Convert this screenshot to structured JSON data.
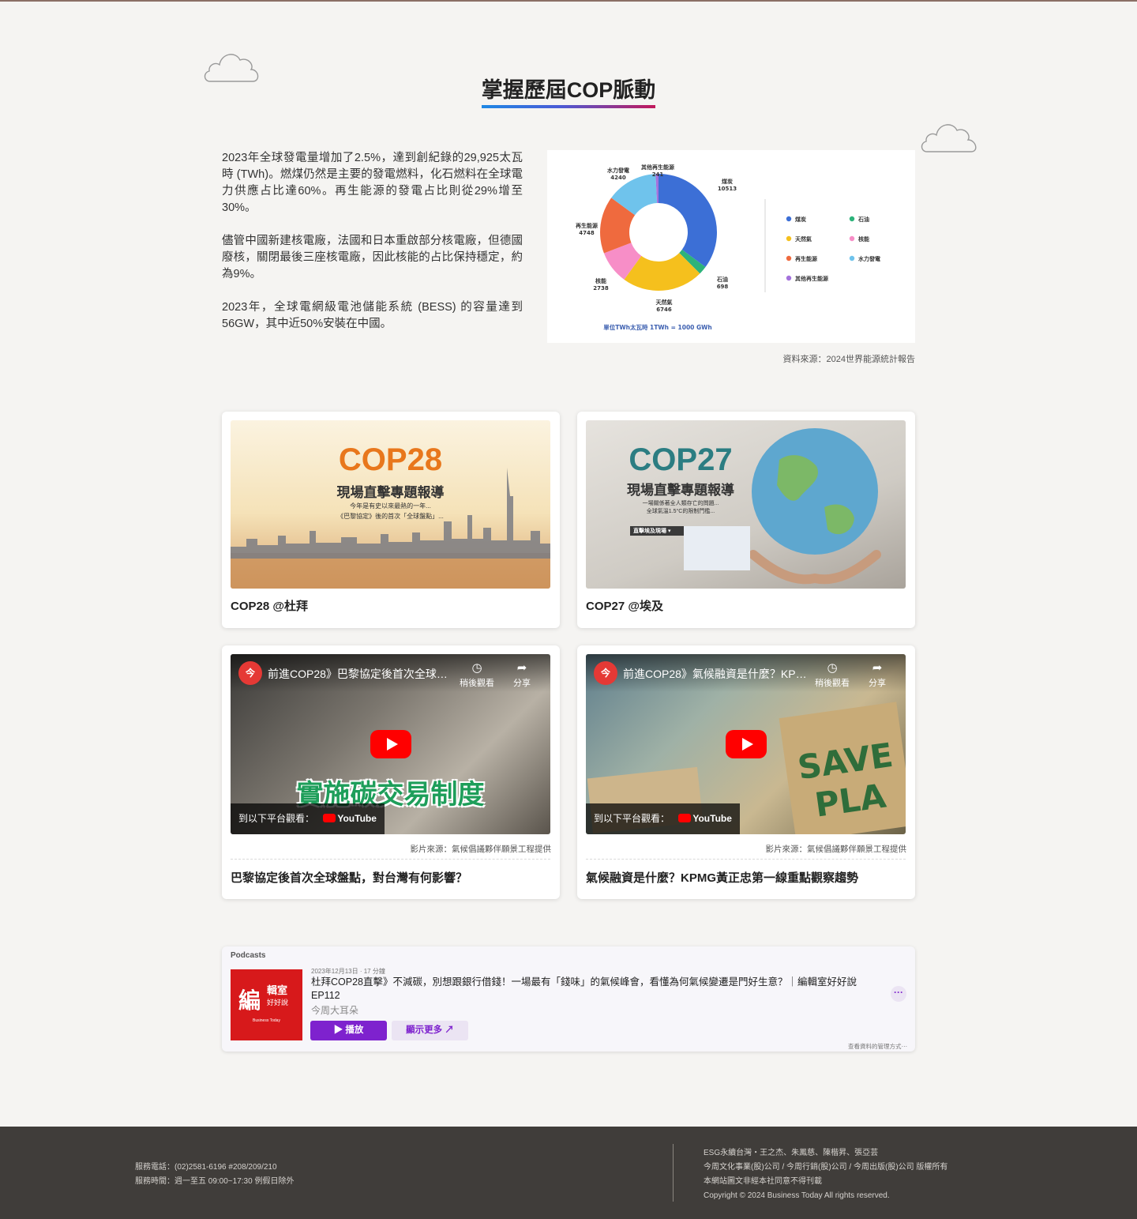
{
  "section": {
    "title": "掌握歷屆COP脈動"
  },
  "intro": {
    "paragraphs": [
      "2023年全球發電量增加了2.5%，達到創紀錄的29,925太瓦時 (TWh)。燃煤仍然是主要的發電燃料，化石燃料在全球電力供應占比達60%。再生能源的發電占比則從29%增至30%。",
      "儘管中國新建核電廠，法國和日本重啟部分核電廠，但德國廢核，關閉最後三座核電廠，因此核能的占比保持穩定，約為9%。",
      "2023年，全球電網級電池儲能系統 (BESS) 的容量達到56GW，其中近50%安裝在中國。"
    ]
  },
  "chart_data": {
    "type": "pie",
    "donut": true,
    "unit_note": "單位TWh太瓦時  1TWh = 1000 GWh",
    "slices": [
      {
        "label": "煤炭",
        "value": 10513,
        "color": "#3c6fd6"
      },
      {
        "label": "石油",
        "value": 698,
        "color": "#2db37a"
      },
      {
        "label": "天然氣",
        "value": 6746,
        "color": "#f5c01d"
      },
      {
        "label": "核能",
        "value": 2738,
        "color": "#f78ec7"
      },
      {
        "label": "再生能源",
        "value": 4748,
        "color": "#ef6a3e"
      },
      {
        "label": "水力發電",
        "value": 4240,
        "color": "#6fc3ec"
      },
      {
        "label": "其他再生能源",
        "value": 241,
        "color": "#a472dc"
      }
    ],
    "legend_placement": "right",
    "legend": [
      "煤炭",
      "石油",
      "天然氣",
      "核能",
      "再生能源",
      "水力發電",
      "其他再生能源"
    ]
  },
  "chart_source": "資料來源：2024世界能源統計報告",
  "colors": {
    "accent_gradient_start": "#1e88e5",
    "accent_gradient_end": "#c2185b",
    "footer_bg": "#403d3a",
    "podcast_purple": "#7e22ce",
    "youtube_red": "#ff0000"
  },
  "cards": [
    {
      "title": "COP28 @杜拜",
      "thumb": {
        "logo": "COP28",
        "headline": "現場直擊專題報導",
        "line1": "今年是有史以來最熱的一年...",
        "line2": "《巴黎協定》後的首次「全球盤點」..."
      }
    },
    {
      "title": "COP27 @埃及",
      "thumb": {
        "logo": "COP27",
        "headline": "現場直擊專題報導",
        "line1": "一場關係著全人類存亡的問題...",
        "line2": "全球氣溫1.5°C的限制門檻...",
        "tag": "直擊埃及現場 ▾"
      }
    }
  ],
  "videos": [
    {
      "video_title": "前進COP28》巴黎協定後首次全球盤...",
      "overlay": "實施碳交易制度",
      "watch_later": "稍後觀看",
      "share": "分享",
      "watch_on": "到以下平台觀看：",
      "yt_logo": "YouTube",
      "source": "影片來源：氣候倡議夥伴願景工程提供",
      "title": "巴黎協定後首次全球盤點，對台灣有何影響？"
    },
    {
      "video_title": "前進COP28》氣候融資是什麼？KPMG...",
      "overlay": "",
      "watch_later": "稍後觀看",
      "share": "分享",
      "watch_on": "到以下平台觀看：",
      "yt_logo": "YouTube",
      "source": "影片來源：氣候倡議夥伴願景工程提供",
      "title": "氣候融資是什麼？KPMG黃正忠第一線重點觀察趨勢"
    }
  ],
  "podcast": {
    "brand": "Podcasts",
    "date": "2023年12月13日 · 17 分鐘",
    "title": "杜拜COP28直擊》不減碳，別想跟銀行借錢！一場最有「錢味」的氣候峰會，看懂為何氣候變遷是門好生意？｜編輯室好好說 EP112",
    "show": "今周大耳朵",
    "play": "播放",
    "more": "顯示更多 ↗",
    "manage": "查看資料的管理方式⋯",
    "art_line1": "編",
    "art_line2": "輯室",
    "art_line3": "好好說",
    "art_line4": "Business Today"
  },
  "footer": {
    "phone": "服務電話：(02)2581-6196 #208/209/210",
    "hours": "服務時間：週一至五 09:00~17:30 例假日除外",
    "credits": "ESG永續台灣・王之杰、朱鳳慈、陳楷昇、張亞芸",
    "companies": "今周文化事業(股)公司 / 今周行銷(股)公司 / 今周出版(股)公司 版權所有",
    "notice": "本網站圖文非經本社同意不得刊載",
    "copyright": "Copyright © 2024 Business Today All rights reserved."
  }
}
